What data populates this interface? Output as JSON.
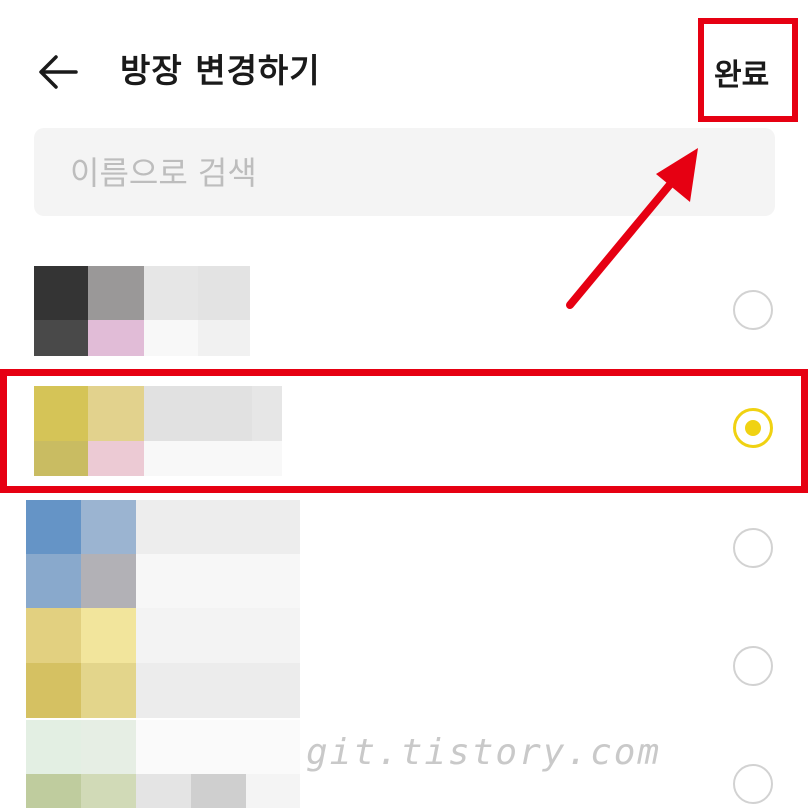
{
  "header": {
    "title": "방장 변경하기",
    "done_label": "완료"
  },
  "search": {
    "placeholder": "이름으로 검색",
    "value": ""
  },
  "members": [
    {
      "selected": false
    },
    {
      "selected": true
    },
    {
      "selected": false
    },
    {
      "selected": false
    },
    {
      "selected": false
    }
  ],
  "watermark": "git.tistory.com",
  "colors": {
    "accent_yellow": "#f0d212",
    "annotation_red": "#e60012"
  }
}
